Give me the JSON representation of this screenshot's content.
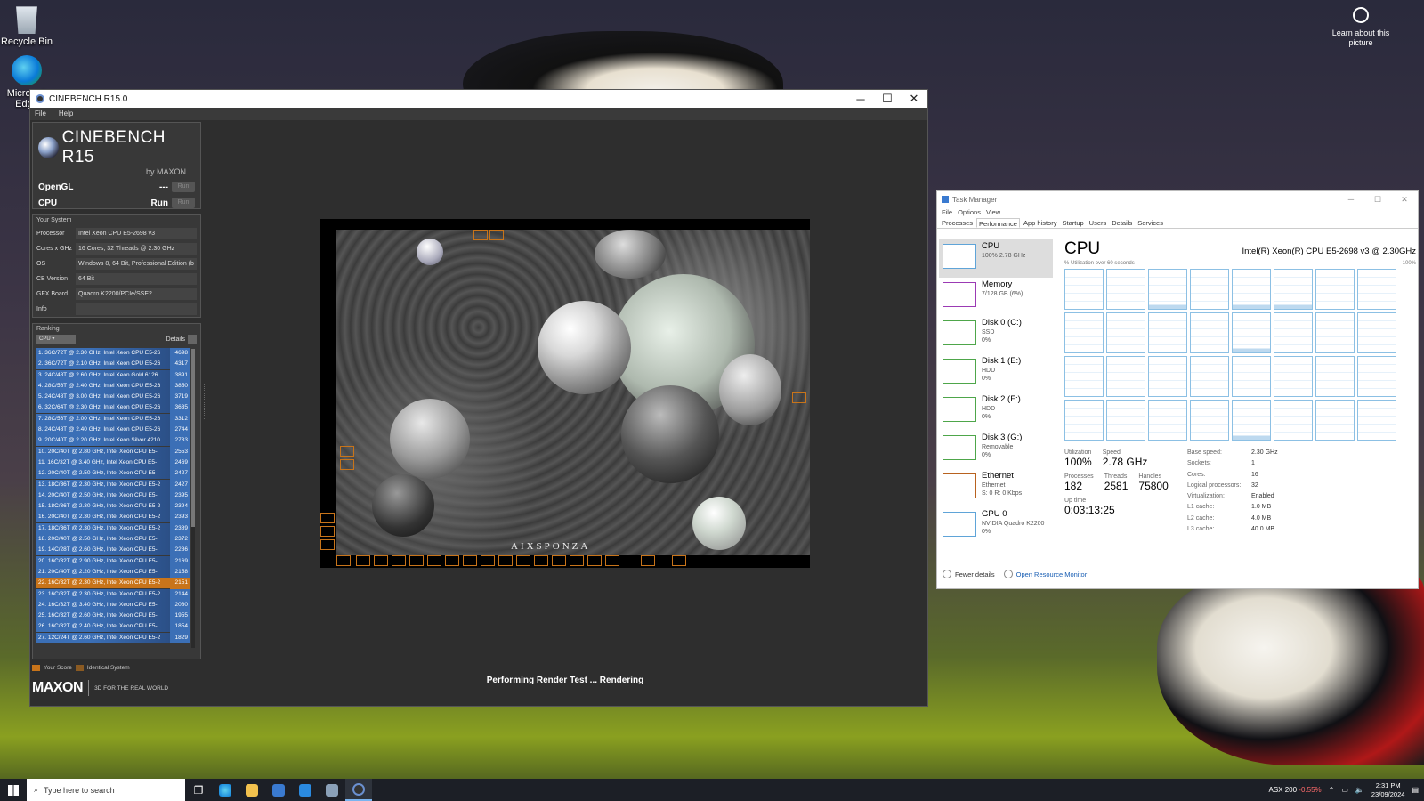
{
  "desktop": {
    "icons": [
      {
        "label": "Recycle Bin"
      },
      {
        "label": "Microsoft Edge"
      }
    ],
    "learn_about": "Learn about this picture"
  },
  "cinebench": {
    "title": "CINEBENCH R15.0",
    "menu": [
      "File",
      "Help"
    ],
    "logo_title": "CINEBENCH R15",
    "logo_sub": "by MAXON",
    "tests": [
      {
        "name": "OpenGL",
        "value": "---",
        "button": "Run"
      },
      {
        "name": "CPU",
        "value": "Run",
        "button": "Run"
      }
    ],
    "your_system_label": "Your System",
    "system": [
      {
        "key": "Processor",
        "value": "Intel Xeon CPU E5-2698 v3"
      },
      {
        "key": "Cores x GHz",
        "value": "16 Cores, 32 Threads @ 2.30 GHz"
      },
      {
        "key": "OS",
        "value": "Windows 8, 64 Bit, Professional Edition (b"
      },
      {
        "key": "CB Version",
        "value": "64 Bit"
      },
      {
        "key": "GFX Board",
        "value": "Quadro K2200/PCIe/SSE2"
      },
      {
        "key": "Info",
        "value": ""
      }
    ],
    "ranking_label": "Ranking",
    "ranking_select": "CPU",
    "details_label": "Details",
    "ranking": [
      {
        "label": "1. 36C/72T @ 2.30 GHz, Intel Xeon CPU E5-26",
        "score": "4698"
      },
      {
        "label": "2. 36C/72T @ 2.10 GHz, Intel Xeon CPU E5-26",
        "score": "4317"
      },
      {
        "label": "3. 24C/48T @ 2.60 GHz, Intel Xeon Gold 6126",
        "score": "3891"
      },
      {
        "label": "4. 28C/56T @ 2.40 GHz, Intel Xeon CPU E5-26",
        "score": "3850"
      },
      {
        "label": "5. 24C/48T @ 3.00 GHz, Intel Xeon CPU E5-26",
        "score": "3719"
      },
      {
        "label": "6. 32C/64T @ 2.30 GHz, Intel Xeon CPU E5-26",
        "score": "3635"
      },
      {
        "label": "7. 28C/56T @ 2.00 GHz, Intel Xeon CPU E5-26",
        "score": "3312"
      },
      {
        "label": "8. 24C/48T @ 2.40 GHz, Intel Xeon CPU E5-26",
        "score": "2744"
      },
      {
        "label": "9. 20C/40T @ 2.20 GHz, Intel Xeon Silver 4210",
        "score": "2733"
      },
      {
        "label": "10. 20C/40T @ 2.80 GHz, Intel Xeon CPU E5-",
        "score": "2553"
      },
      {
        "label": "11. 16C/32T @ 3.40 GHz, Intel Xeon CPU E5-",
        "score": "2469"
      },
      {
        "label": "12. 20C/40T @ 2.50 GHz, Intel Xeon CPU E5-",
        "score": "2427"
      },
      {
        "label": "13. 18C/36T @ 2.30 GHz, Intel Xeon CPU E5-2",
        "score": "2427"
      },
      {
        "label": "14. 20C/40T @ 2.50 GHz, Intel Xeon CPU E5-",
        "score": "2395"
      },
      {
        "label": "15. 18C/36T @ 2.30 GHz, Intel Xeon CPU E5-2",
        "score": "2394"
      },
      {
        "label": "16. 20C/40T @ 2.30 GHz, Intel Xeon CPU E5-2",
        "score": "2393"
      },
      {
        "label": "17. 18C/36T @ 2.30 GHz, Intel Xeon CPU E5-2",
        "score": "2389"
      },
      {
        "label": "18. 20C/40T @ 2.50 GHz, Intel Xeon CPU E5-",
        "score": "2372"
      },
      {
        "label": "19. 14C/28T @ 2.60 GHz, Intel Xeon CPU E5-",
        "score": "2286"
      },
      {
        "label": "20. 16C/32T @ 2.90 GHz, Intel Xeon CPU E5-",
        "score": "2169"
      },
      {
        "label": "21. 20C/40T @ 2.20 GHz, Intel Xeon CPU E5-",
        "score": "2158"
      },
      {
        "label": "22. 16C/32T @ 2.30 GHz, Intel Xeon CPU E5-2",
        "score": "2151",
        "yours": true
      },
      {
        "label": "23. 16C/32T @ 2.30 GHz, Intel Xeon CPU E5-2",
        "score": "2144"
      },
      {
        "label": "24. 16C/32T @ 3.40 GHz, Intel Xeon CPU E5-",
        "score": "2080"
      },
      {
        "label": "25. 16C/32T @ 2.60 GHz, Intel Xeon CPU E5-",
        "score": "1955"
      },
      {
        "label": "26. 16C/32T @ 2.40 GHz, Intel Xeon CPU E5-",
        "score": "1854"
      },
      {
        "label": "27. 12C/24T @ 2.60 GHz, Intel Xeon CPU E5-2",
        "score": "1829"
      }
    ],
    "legend": {
      "your_score": "Your Score",
      "identical": "Identical System"
    },
    "brand": "MAXON",
    "tagline": "3D FOR THE REAL WORLD",
    "render_status": "Performing Render Test ... Rendering",
    "render_credit": "AIXSPONZA",
    "colors": {
      "rank_blue": "#3b6fb6",
      "your_score": "#c8741a"
    }
  },
  "taskmanager": {
    "title": "Task Manager",
    "menu": [
      "File",
      "Options",
      "View"
    ],
    "tabs": [
      "Processes",
      "Performance",
      "App history",
      "Startup",
      "Users",
      "Details",
      "Services"
    ],
    "active_tab": "Performance",
    "sidebar": [
      {
        "title": "CPU",
        "sub1": "100% 2.78 GHz",
        "sub2": "",
        "kind": "cpu"
      },
      {
        "title": "Memory",
        "sub1": "7/128 GB (6%)",
        "sub2": "",
        "kind": "mem"
      },
      {
        "title": "Disk 0 (C:)",
        "sub1": "SSD",
        "sub2": "0%",
        "kind": "disk"
      },
      {
        "title": "Disk 1 (E:)",
        "sub1": "HDD",
        "sub2": "0%",
        "kind": "disk"
      },
      {
        "title": "Disk 2 (F:)",
        "sub1": "HDD",
        "sub2": "0%",
        "kind": "disk"
      },
      {
        "title": "Disk 3 (G:)",
        "sub1": "Removable",
        "sub2": "0%",
        "kind": "disk"
      },
      {
        "title": "Ethernet",
        "sub1": "Ethernet",
        "sub2": "S: 0 R: 0 Kbps",
        "kind": "eth"
      },
      {
        "title": "GPU 0",
        "sub1": "NVIDIA Quadro K2200",
        "sub2": "0%",
        "kind": "cpu"
      }
    ],
    "main": {
      "heading": "CPU",
      "model": "Intel(R) Xeon(R) CPU E5-2698 v3 @ 2.30GHz",
      "util_label": "% Utilization over 60 seconds",
      "util_max": "100%",
      "core_count": 32,
      "stats": {
        "utilization_label": "Utilization",
        "utilization": "100%",
        "speed_label": "Speed",
        "speed": "2.78 GHz",
        "processes_label": "Processes",
        "processes": "182",
        "threads_label": "Threads",
        "threads": "2581",
        "handles_label": "Handles",
        "handles": "75800",
        "uptime_label": "Up time",
        "uptime": "0:03:13:25"
      },
      "specs": [
        {
          "key": "Base speed:",
          "value": "2.30 GHz"
        },
        {
          "key": "Sockets:",
          "value": "1"
        },
        {
          "key": "Cores:",
          "value": "16"
        },
        {
          "key": "Logical processors:",
          "value": "32"
        },
        {
          "key": "Virtualization:",
          "value": "Enabled"
        },
        {
          "key": "L1 cache:",
          "value": "1.0 MB"
        },
        {
          "key": "L2 cache:",
          "value": "4.0 MB"
        },
        {
          "key": "L3 cache:",
          "value": "40.0 MB"
        }
      ]
    },
    "footer": {
      "fewer": "Fewer details",
      "resource_monitor": "Open Resource Monitor"
    }
  },
  "taskbar": {
    "search_placeholder": "Type here to search",
    "stock_name": "ASX 200",
    "stock_change": "-0.55%",
    "time": "2:31 PM",
    "date": "23/09/2024"
  }
}
